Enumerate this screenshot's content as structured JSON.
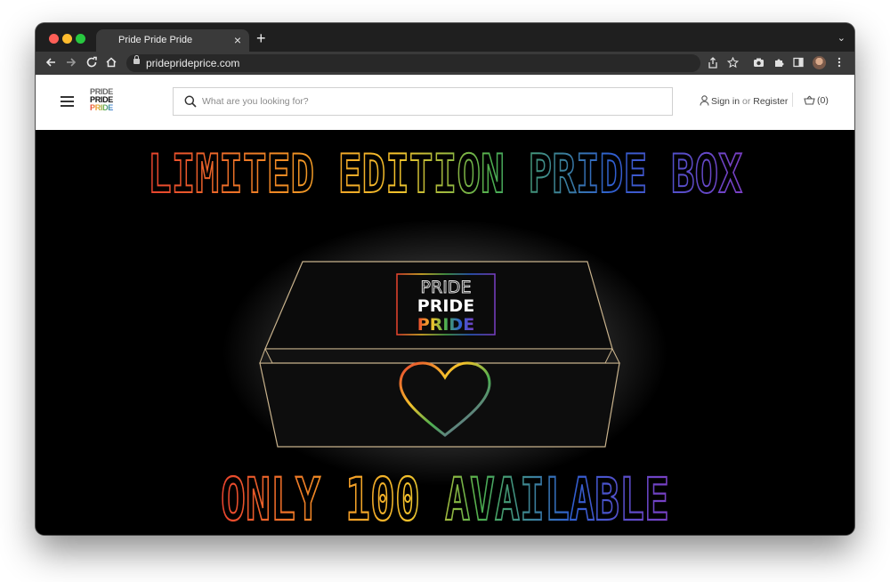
{
  "browser": {
    "tab_title": "Pride Pride Pride",
    "tab_close": "×",
    "new_tab": "+",
    "tab_menu": "⌄",
    "url": "prideprideprice.com"
  },
  "site": {
    "logo_lines": [
      "PRIDE",
      "PRIDE",
      "PRIDE"
    ],
    "search_placeholder": "What are you looking for?",
    "sign_in": "Sign in",
    "or": "or",
    "register": "Register",
    "cart": "(0)"
  },
  "hero": {
    "headline": "LIMITED EDITION PRIDE BOX",
    "box_logo": [
      "PRIDE",
      "PRIDE",
      "PRIDE"
    ],
    "subline": "ONLY 100 AVAILABLE"
  },
  "colors": {
    "red": "#e8432e",
    "orange": "#f08a24",
    "yellow": "#f4c22b",
    "green": "#4caf50",
    "blue": "#2f5fd0",
    "purple": "#7a3fc4"
  }
}
